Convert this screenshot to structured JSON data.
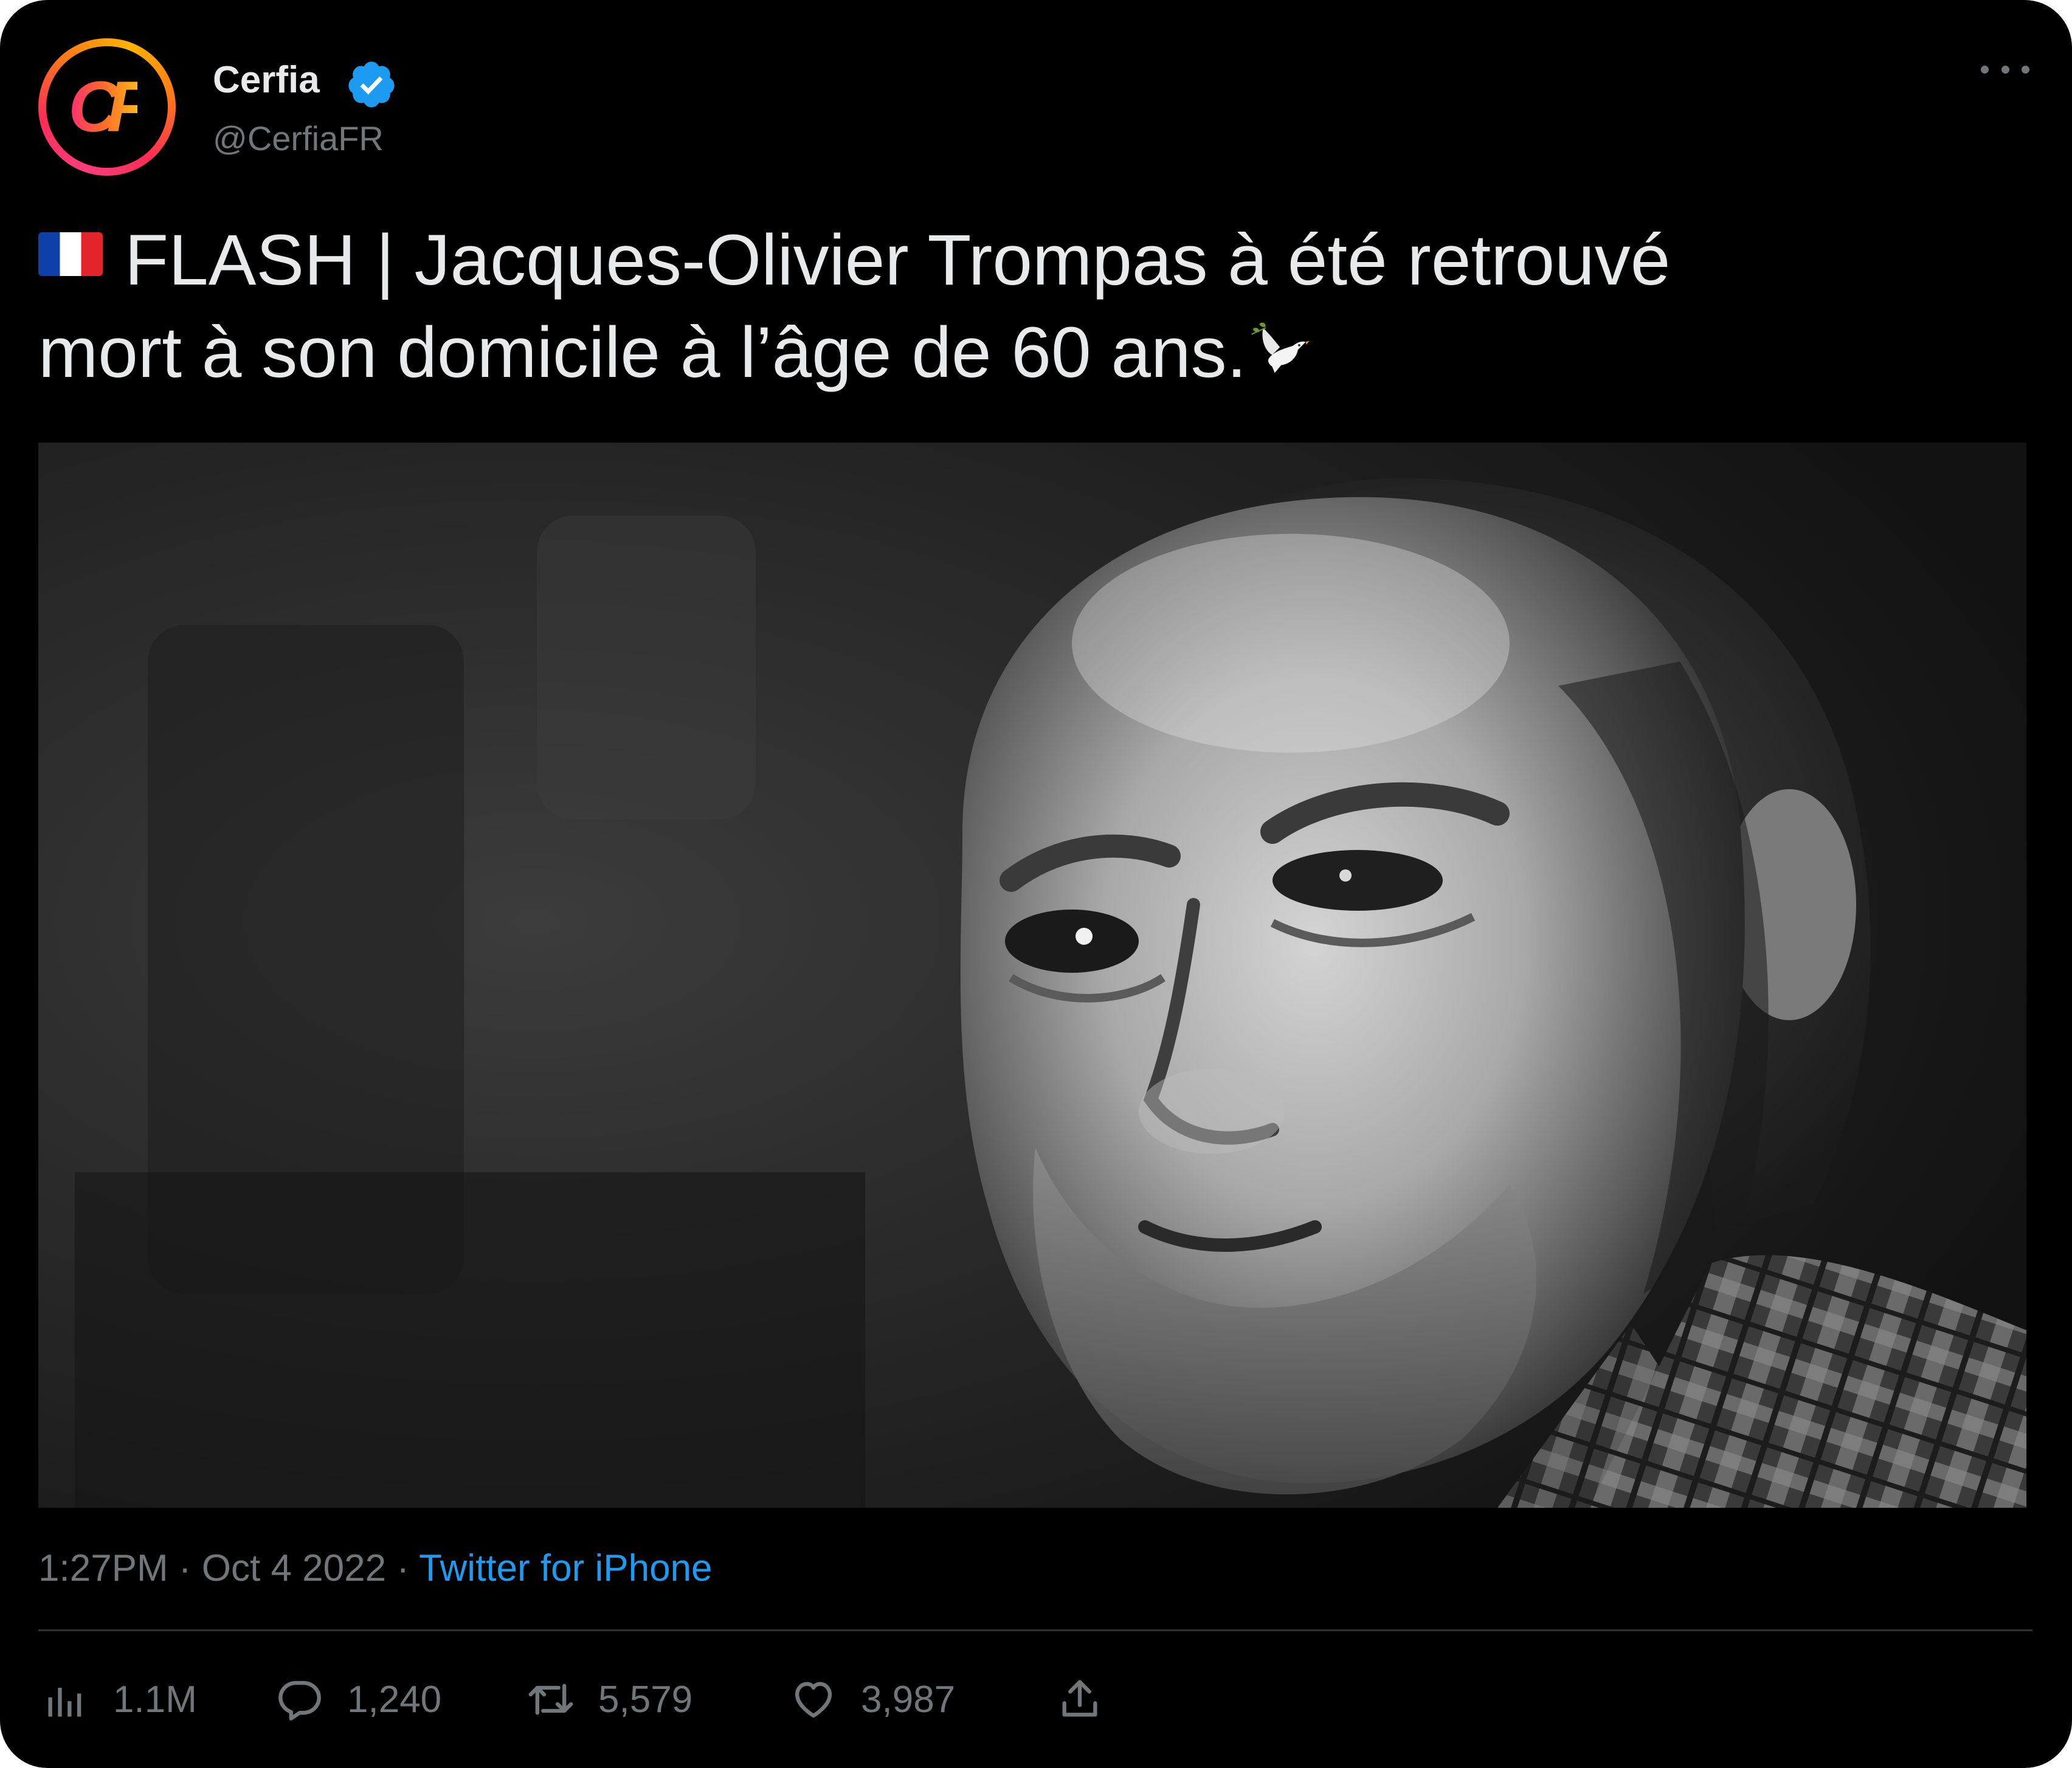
{
  "author": {
    "avatar_text": "CF",
    "display_name": "Cerfia",
    "handle": "@CerfiaFR",
    "verified": true
  },
  "tweet": {
    "line1": "FLASH | Jacques-Olivier Trompas à été retrouvé",
    "line2": "mort à son domicile à l’âge de 60 ans.",
    "flag_icon": "france-flag-icon",
    "emoji_icon": "dove-icon"
  },
  "media": {
    "subject_icon": "portrait-photo-icon"
  },
  "meta": {
    "time": "1:27PM",
    "separator": " · ",
    "date": "Oct 4 2022",
    "source": "Twitter for iPhone"
  },
  "actions": {
    "views": "1.1M",
    "replies": "1,240",
    "retweets": "5,579",
    "likes": "3,987"
  },
  "colors": {
    "background": "#000000",
    "text": "#e7e9ea",
    "secondary": "#71767b",
    "link": "#1d9bf0",
    "divider": "#2f3336",
    "verified": "#1d9bf0"
  }
}
